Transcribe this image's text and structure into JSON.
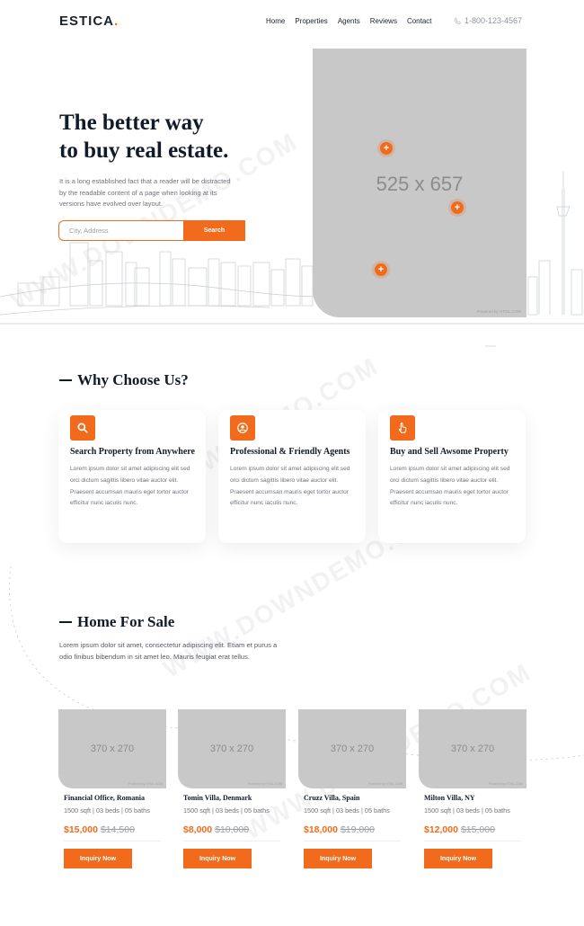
{
  "header": {
    "logo": "ESTICA",
    "logo_dot": ".",
    "nav": [
      "Home",
      "Properties",
      "Agents",
      "Reviews",
      "Contact"
    ],
    "phone": "1-800-123-4567"
  },
  "hero": {
    "title_line1": "The better way",
    "title_line2": "to buy real estate.",
    "description": "It is a long established fact that a reader will be distracted by the readable content of a page when looking at its versions have evolved over layout.",
    "search_placeholder": "City, Address",
    "search_button": "Search",
    "image_size": "525 x 657",
    "image_credit": "Powered by HTML.COM",
    "pin_symbol": "+"
  },
  "why": {
    "title": "Why Choose Us?",
    "cards": [
      {
        "title": "Search Property from Anywhere",
        "icon": "search-icon",
        "text": "Lorem ipsum dolor sit amet adipiscing elit sed orci dictum sagittis libero vitae auctor elit. Praesent accumsan mauris eget tortor auctor efficitur nunc iaculis nunc."
      },
      {
        "title": "Professional & Friendly Agents",
        "icon": "user-icon",
        "text": "Lorem ipsum dolor sit amet adipiscing elit sed orci dictum sagittis libero vitae auctor elit. Praesent accumsan mauris eget tortor auctor efficitur nunc iaculis nunc."
      },
      {
        "title": "Buy and Sell Awsome Property",
        "icon": "hand-pointer-icon",
        "text": "Lorem ipsum dolor sit amet adipiscing elit sed orci dictum sagittis libero vitae auctor elit. Praesent accumsan mauris eget tortor auctor efficitur nunc iaculis nunc."
      }
    ]
  },
  "sale": {
    "title": "Home For Sale",
    "description": "Lorem ipsum dolor sit amet, consectetur adipiscing elit. Etiam et purus a odio finibus bibendum in sit amet leo. Mauris feugiat erat tellus.",
    "properties": [
      {
        "image_size": "370 x 270",
        "image_credit": "Powered by HTML.COM",
        "name": "Financial Office, Romania",
        "info": "1500 sqft | 03 beds | 05 baths",
        "price": "$15,000",
        "old_price": "$14,500",
        "button": "Inquiry Now"
      },
      {
        "image_size": "370 x 270",
        "image_credit": "Powered by HTML.COM",
        "name": "Tomin Villa, Denmark",
        "info": "1500 sqft | 03 beds | 05 baths",
        "price": "$8,000",
        "old_price": "$10,000",
        "button": "Inquiry Now"
      },
      {
        "image_size": "370 x 270",
        "image_credit": "Powered by HTML.COM",
        "name": "Cruzz Villa, Spain",
        "info": "1500 sqft | 03 beds | 05 baths",
        "price": "$18,000",
        "old_price": "$19,000",
        "button": "Inquiry Now"
      },
      {
        "image_size": "370 x 270",
        "image_credit": "Powered by HTML.COM",
        "name": "Milton Villa, NY",
        "info": "1500 sqft | 03 beds | 05 baths",
        "price": "$12,000",
        "old_price": "$15,000",
        "button": "Inquiry Now"
      }
    ]
  },
  "watermark": "WWW.DOWNDEMO.COM",
  "colors": {
    "accent": "#f26a1b",
    "dark": "#121b2a",
    "placeholder": "#c8c8c8"
  }
}
